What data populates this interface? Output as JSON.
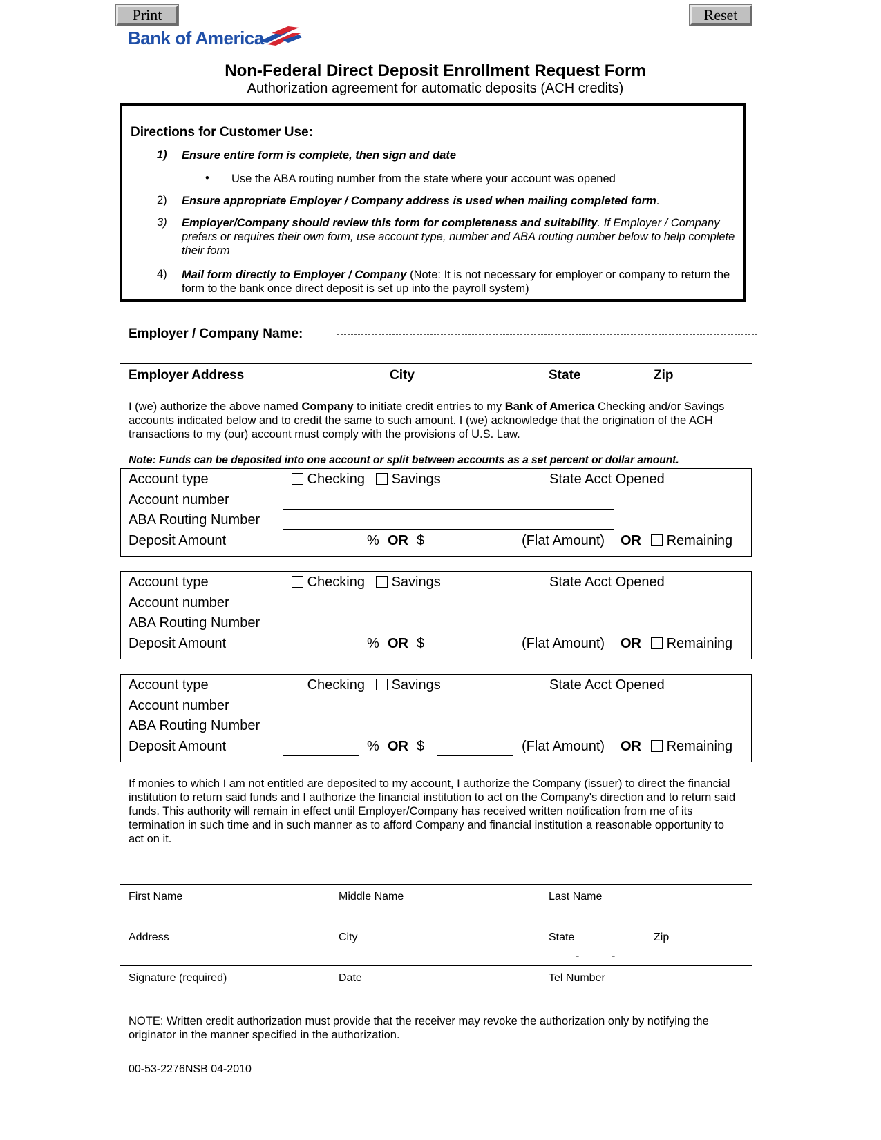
{
  "toolbar": {
    "print_label": "Print",
    "reset_label": "Reset"
  },
  "brand": {
    "logo_text": "Bank of America",
    "logo_icon": "flag-icon",
    "colors": {
      "blue": "#1f4fa8",
      "red": "#d62631"
    }
  },
  "header": {
    "title": "Non-Federal Direct Deposit Enrollment Request Form",
    "subtitle": "Authorization agreement for automatic deposits (ACH credits)"
  },
  "directions": {
    "heading": "Directions for Customer Use:",
    "items": [
      {
        "num": "1)",
        "bold": "Ensure entire form is complete, then sign and date",
        "rest": ""
      },
      {
        "num": "•",
        "bold": "",
        "rest": "Use the ABA routing number from the state where your account was opened"
      },
      {
        "num": "2)",
        "bold": "Ensure appropriate Employer / Company address is used when mailing completed form",
        "rest": "."
      },
      {
        "num": "3)",
        "bold": "Employer/Company should review this form for completeness and suitability",
        "rest": ". If Employer / Company prefers or requires  their own form, use account type, number and ABA routing number below to help complete their form"
      },
      {
        "num": "4)",
        "bold": "Mail form directly to Employer / Company",
        "rest": " (Note: It is not necessary for employer or company to return the form to the bank once direct deposit is set up into the payroll system)"
      }
    ]
  },
  "employer": {
    "name_label": "Employer  / Company Name:",
    "name_value": "",
    "address_label": "Employer  Address",
    "city_label": "City",
    "state_label": "State",
    "zip_label": "Zip"
  },
  "authorization": {
    "p1_a": "I (we) authorize the above named ",
    "p1_b": "Company",
    "p1_c": " to initiate credit entries to my ",
    "p1_d": "Bank of America",
    "p1_e": " Checking and/or Savings accounts indicated below and to credit the same to such amount. I (we) acknowledge that the origination of the ACH transactions to my (our) account must comply with the provisions of U.S. Law.",
    "note": "Note:  Funds can be deposited into one account or split between accounts as a set percent or dollar amount."
  },
  "accounts": [
    {
      "type_label": "Account type",
      "checking": "Checking",
      "savings": "Savings",
      "state_label": "State Acct Opened",
      "number_label": "Account number",
      "aba_label": "ABA Routing Number",
      "deposit_label": "Deposit Amount",
      "pct": "%",
      "or1": "OR",
      "dollar": "$",
      "flat": "(Flat Amount)",
      "or2": "OR",
      "remaining": "Remaining",
      "checking_checked": false,
      "savings_checked": false,
      "remaining_checked": false
    },
    {
      "type_label": "Account type",
      "checking": "Checking",
      "savings": "Savings",
      "state_label": "State Acct Opened",
      "number_label": "Account number",
      "aba_label": "ABA Routing Number",
      "deposit_label": "Deposit Amount",
      "pct": "%",
      "or1": "OR",
      "dollar": "$",
      "flat": "(Flat Amount)",
      "or2": "OR",
      "remaining": "Remaining",
      "checking_checked": false,
      "savings_checked": false,
      "remaining_checked": false
    },
    {
      "type_label": "Account type",
      "checking": "Checking",
      "savings": "Savings",
      "state_label": "State Acct Opened",
      "number_label": "Account number",
      "aba_label": "ABA Routing Number",
      "deposit_label": "Deposit Amount",
      "pct": "%",
      "or1": "OR",
      "dollar": "$",
      "flat": "(Flat Amount)",
      "or2": "OR",
      "remaining": "Remaining",
      "checking_checked": false,
      "savings_checked": false,
      "remaining_checked": false
    }
  ],
  "return_clause": "If monies to which I am not entitled are deposited to my account, I authorize the Company (issuer) to direct the financial institution to return said funds and I authorize the financial institution to act on the Company's direction and to return said funds. This authority will remain in effect until Employer/Company has received written notification from me of its termination in such time and in such manner as to afford Company and financial institution a reasonable opportunity to act on it.",
  "customer": {
    "first_name": "First Name",
    "middle_name": "Middle Name",
    "last_name": "Last Name",
    "address": "Address",
    "city": "City",
    "state": "State",
    "zip": "Zip",
    "phone_sep1": "-",
    "phone_sep2": "-",
    "signature": "Signature (required)",
    "date": "Date",
    "tel": "Tel Number"
  },
  "footer": {
    "note": "NOTE:  Written credit authorization must provide that the receiver may revoke the authorization only by notifying the originator in the manner specified in the authorization.",
    "form_code": "00-53-2276NSB  04-2010"
  }
}
